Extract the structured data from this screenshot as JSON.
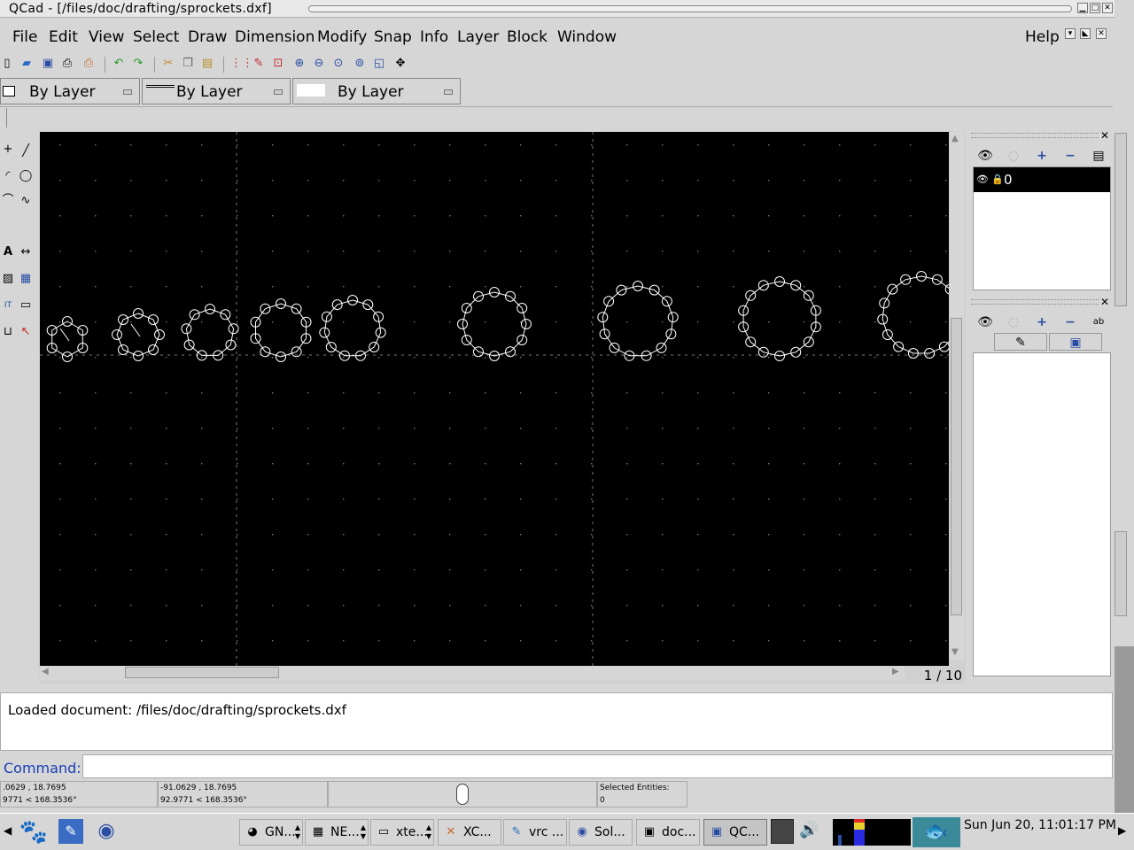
{
  "window": {
    "title": "QCad - [/files/doc/drafting/sprockets.dxf]"
  },
  "menu": {
    "items": [
      "File",
      "Edit",
      "View",
      "Select",
      "Draw",
      "Dimension",
      "Modify",
      "Snap",
      "Info",
      "Layer",
      "Block",
      "Window"
    ],
    "help": "Help"
  },
  "pen": {
    "color": "By Layer",
    "width": "By Layer",
    "linetype": "By Layer"
  },
  "drawing": {
    "page_indicator": "1 / 10"
  },
  "layers": {
    "items": [
      "0"
    ]
  },
  "console": {
    "message": "Loaded document: /files/doc/drafting/sprockets.dxf"
  },
  "command": {
    "label": "Command:",
    "value": ""
  },
  "status": {
    "abs_coord": ".0629 , 18.7695",
    "abs_polar": "9771 < 168.3536°",
    "rel_coord": "-91.0629 , 18.7695",
    "rel_polar": "92.9771 < 168.3536°",
    "selected_label": "Selected Entities:",
    "selected_count": "0"
  },
  "taskbar": {
    "tasks": [
      "GN...",
      "NE...",
      "xte...",
      "XC...",
      "vrc ...",
      "Sol...",
      "doc...",
      "QC..."
    ],
    "clock": "Sun Jun 20, 11:01:17 PM"
  },
  "colors": {
    "canvas": "#000000",
    "chrome": "#d6d6d6",
    "command_label": "#1a3eb5",
    "entity": "#ffffff"
  },
  "icons": {
    "toolbar": [
      "new-file-icon",
      "open-file-icon",
      "save-icon",
      "print-icon",
      "print-preview-icon",
      "undo-icon",
      "redo-icon",
      "cut-icon",
      "copy-icon",
      "paste-icon",
      "grid-icon",
      "draft-icon",
      "redraw-icon",
      "zoom-in-icon",
      "zoom-out-icon",
      "zoom-auto-icon",
      "zoom-previous-icon",
      "zoom-window-icon",
      "zoom-pan-icon"
    ]
  }
}
